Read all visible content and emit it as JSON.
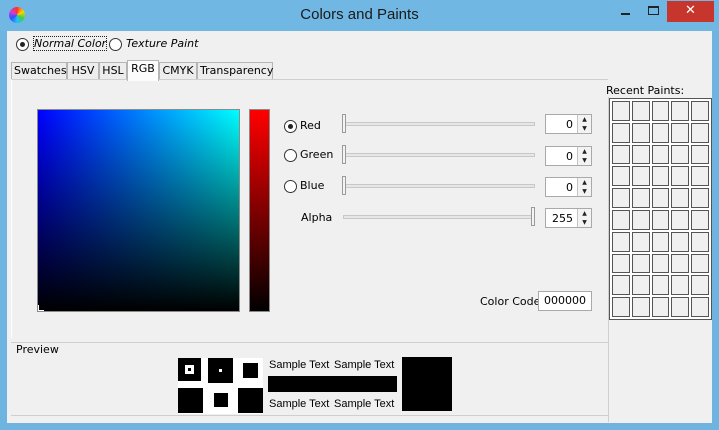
{
  "window": {
    "title": "Colors and Paints",
    "minimize_glyph": "",
    "maximize_glyph": "",
    "close_glyph": "✕"
  },
  "paint_type": {
    "options": [
      {
        "label": "Normal Color",
        "selected": true
      },
      {
        "label": "Texture Paint",
        "selected": false
      }
    ]
  },
  "tabs": [
    {
      "label": "Swatches",
      "active": false
    },
    {
      "label": "HSV",
      "active": false
    },
    {
      "label": "HSL",
      "active": false
    },
    {
      "label": "RGB",
      "active": true
    },
    {
      "label": "CMYK",
      "active": false
    },
    {
      "label": "Transparency",
      "active": false
    }
  ],
  "rgb": {
    "channels": [
      {
        "label": "Red",
        "value": "0",
        "selected": true,
        "max": 255
      },
      {
        "label": "Green",
        "value": "0",
        "selected": false,
        "max": 255
      },
      {
        "label": "Blue",
        "value": "0",
        "selected": false,
        "max": 255
      }
    ],
    "alpha": {
      "label": "Alpha",
      "value": "255",
      "max": 255
    },
    "color_code_label": "Color Code",
    "color_code": "000000"
  },
  "recent_paints": {
    "label": "Recent Paints:",
    "rows": 10,
    "cols": 5
  },
  "preview": {
    "label": "Preview",
    "sample_text": "Sample Text"
  },
  "colors": {
    "titlebar": "#70b7e4",
    "close_button": "#c7362c",
    "current_color": "#000000"
  }
}
